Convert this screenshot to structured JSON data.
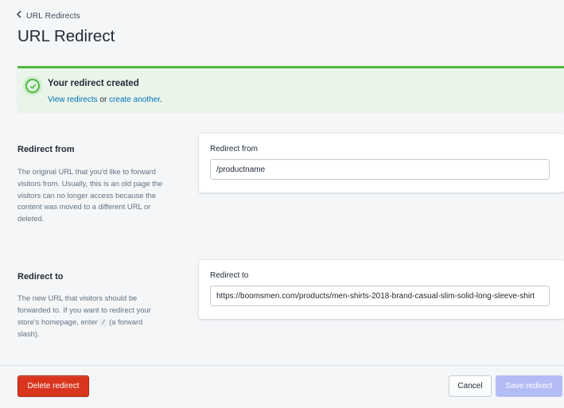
{
  "breadcrumb": {
    "label": "URL Redirects",
    "icon": "chevron-left-icon"
  },
  "page": {
    "title": "URL Redirect"
  },
  "banner": {
    "title": "Your redirect created",
    "link_view": "View redirects",
    "connector": "or",
    "link_create": "create another",
    "end": ".",
    "icon": "checkmark-circle-icon",
    "accent_color": "#50b83c"
  },
  "from_section": {
    "title": "Redirect from",
    "description": "The original URL that you'd like to forward visitors from. Usually, this is an old page the visitors can no longer access because the content was moved to a different URL or deleted.",
    "field_label": "Redirect from",
    "field_value": "/productname"
  },
  "to_section": {
    "title": "Redirect to",
    "description_before": "The new URL that visitors should be forwarded to. If you want to redirect your store's homepage, enter",
    "description_code": "/",
    "description_after": "(a forward slash).",
    "field_label": "Redirect to",
    "field_value": "https://boomsmen.com/products/men-shirts-2018-brand-casual-slim-solid-long-sleeve-shirt"
  },
  "footer": {
    "delete_label": "Delete redirect",
    "cancel_label": "Cancel",
    "save_label": "Save redirect",
    "delete_color": "#d9341d",
    "save_color": "#b3bcf5"
  }
}
